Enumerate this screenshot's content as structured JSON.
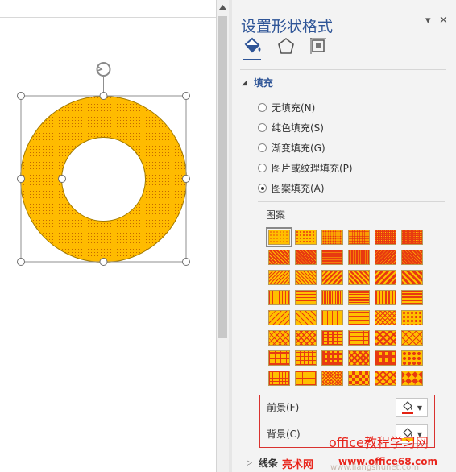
{
  "pane": {
    "title": "设置形状格式",
    "dropdown_glyph": "▾",
    "close_glyph": "✕",
    "tabs": [
      {
        "name": "fill-line-tab-icon",
        "selected": true
      },
      {
        "name": "effects-tab-icon",
        "selected": false
      },
      {
        "name": "size-properties-tab-icon",
        "selected": false
      }
    ]
  },
  "fill": {
    "section_label": "填充",
    "options": [
      {
        "label": "无填充(N)",
        "checked": false
      },
      {
        "label": "纯色填充(S)",
        "checked": false
      },
      {
        "label": "渐变填充(G)",
        "checked": false
      },
      {
        "label": "图片或纹理填充(P)",
        "checked": false
      },
      {
        "label": "图案填充(A)",
        "checked": true
      }
    ],
    "pattern_label": "图案",
    "pattern_grid": {
      "rows": 8,
      "cols": 6,
      "selected_index": 0
    },
    "foreground_label": "前景(F)",
    "background_label": "背景(C)"
  },
  "line": {
    "section_label": "线条"
  },
  "colors": {
    "pattern_fg": "#e83a10",
    "pattern_bg": "#ffc000",
    "accent": "#2f5597",
    "highlight_box": "#d9312e",
    "donut_fill": "#ffbb00"
  },
  "watermarks": {
    "site": "office教程学习网",
    "brand": "亮术网",
    "url": "www.office68.com",
    "url_faint": "www.liangshunet.com"
  }
}
